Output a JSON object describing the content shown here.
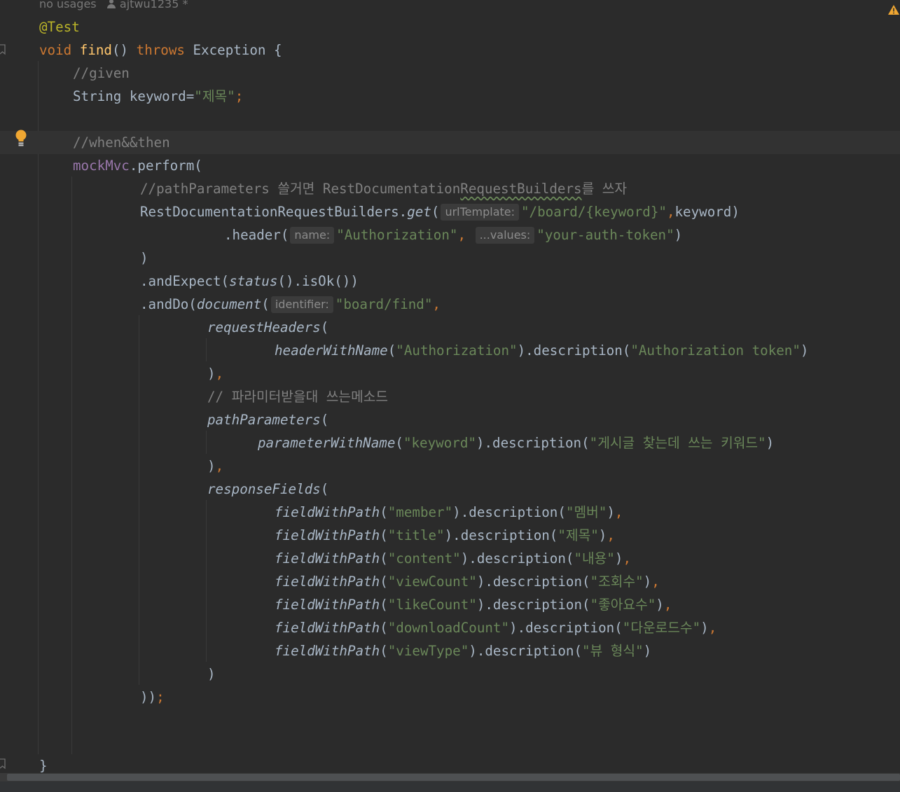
{
  "meta": {
    "usages": "no usages",
    "author": "ajtwu1235 *"
  },
  "hints": {
    "urlTemplate": "urlTemplate:",
    "name": "name:",
    "values": "...values:",
    "identifier": "identifier:"
  },
  "code": {
    "annotation": "@Test",
    "kw_void": "void ",
    "method_name": "find",
    "parens": "() ",
    "kw_throws": "throws",
    "exception": " Exception {",
    "cmt_given": "//given",
    "keyword_decl": "String keyword=",
    "keyword_value": "\"제목\"",
    "semicolon": ";",
    "cmt_when": "//when&&then",
    "mockmvc": "mockMvc",
    "perform": ".perform(",
    "cmt_pathparams_a": "//pathParameters 쓸거면 RestDocumentation",
    "cmt_pathparams_b": "RequestBuilders",
    "cmt_pathparams_c": "를 쓰자",
    "builders": "RestDocumentationRequestBuilders.",
    "get": "get",
    "open_paren": "(",
    "url_value": "\"/board/{keyword}\"",
    "comma": ",",
    "keyword_arg": "keyword)",
    "header": ".header(",
    "auth_header": "\"Authorization\"",
    "comma_space": ", ",
    "token_value": "\"your-auth-token\"",
    "close_paren": ")",
    "and_expect": ".andExpect(",
    "status": "status",
    "is_ok": "().isOk())",
    "and_do": ".andDo(",
    "document": "document",
    "doc_id": "\"board/find\"",
    "request_headers": "requestHeaders",
    "header_with_name": "headerWithName",
    "description": ").description(",
    "auth_desc": "\"Authorization token\"",
    "close_comma_paren": ")",
    "cmt_params": "// 파라미터받을대 쓰는메소드",
    "path_parameters": "pathParameters",
    "parameter_with_name": "parameterWithName",
    "param_keyword": "\"keyword\"",
    "param_desc": "\"게시글 찾는데 쓰는 키워드\"",
    "response_fields": "responseFields",
    "field_with_path": "fieldWithPath",
    "end_all": "))",
    "close_brace": "}"
  },
  "fields": [
    {
      "path": "\"member\"",
      "desc": "\"멤버\"",
      "trailing": ","
    },
    {
      "path": "\"title\"",
      "desc": "\"제목\"",
      "trailing": ","
    },
    {
      "path": "\"content\"",
      "desc": "\"내용\"",
      "trailing": ","
    },
    {
      "path": "\"viewCount\"",
      "desc": "\"조회수\"",
      "trailing": ","
    },
    {
      "path": "\"likeCount\"",
      "desc": "\"좋아요수\"",
      "trailing": ","
    },
    {
      "path": "\"downloadCount\"",
      "desc": "\"다운로드수\"",
      "trailing": ","
    },
    {
      "path": "\"viewType\"",
      "desc": "\"뷰 형식\"",
      "trailing": ""
    }
  ],
  "colors": {
    "background": "#2b2b2b",
    "keyword": "#cc7832",
    "string": "#6a8759",
    "comment": "#808080",
    "annotation": "#bbb529",
    "method": "#ffc66d",
    "field": "#9876aa",
    "text": "#a9b7c6",
    "bulb": "#f0a732",
    "warning": "#f0a732"
  },
  "icons": {
    "bulb": "lightbulb-icon",
    "warning": "warning-icon",
    "author": "user-icon",
    "bookmark": "bookmark-icon"
  }
}
